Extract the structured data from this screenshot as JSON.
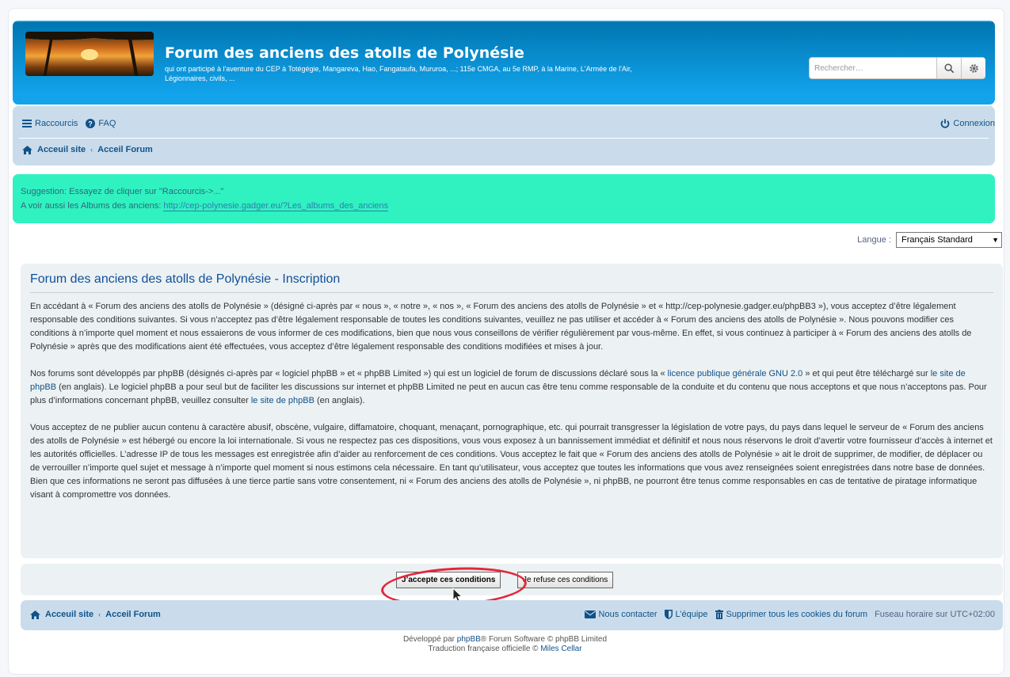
{
  "header": {
    "site_title": "Forum des anciens des atolls de Polynésie",
    "site_description": "qui ont participé à l'aventure du CEP à Totégégie, Mangareva, Hao, Fangataufa, Mururoa, ...; 115e CMGA, au 5e RMP, à la Marine, L'Armée de l'Air, Légionnaires, civils, ...",
    "search_placeholder": "Rechercher…"
  },
  "navbar": {
    "shortcuts_label": "Raccourcis",
    "faq_label": "FAQ",
    "login_label": "Connexion",
    "breadcrumb": [
      "Acceuil site",
      "Acceil Forum"
    ]
  },
  "notice": {
    "line1": "Suggestion: Essayez de cliquer sur \"Raccourcis->...\"",
    "line2_prefix": "A voir aussi les Albums des anciens: ",
    "line2_link": "http://cep-polynesie.gadger.eu/?Les_albums_des_anciens"
  },
  "language": {
    "label": "Langue :",
    "selected": "Français Standard"
  },
  "terms": {
    "title": "Forum des anciens des atolls de Polynésie - Inscription",
    "para1": "En accédant à « Forum des anciens des atolls de Polynésie » (désigné ci-après par « nous », « notre », « nos », « Forum des anciens des atolls de Polynésie » et « http://cep-polynesie.gadger.eu/phpBB3 »), vous acceptez d’être légalement responsable des conditions suivantes. Si vous n’acceptez pas d’être légalement responsable de toutes les conditions suivantes, veuillez ne pas utiliser et accéder à « Forum des anciens des atolls de Polynésie ». Nous pouvons modifier ces conditions à n’importe quel moment et nous essaierons de vous informer de ces modifications, bien que nous vous conseillons de vérifier régulièrement par vous-même. En effet, si vous continuez à participer à « Forum des anciens des atolls de Polynésie » après que des modifications aient été effectuées, vous acceptez d’être légalement responsable des conditions modifiées et mises à jour.",
    "para2_a": "Nos forums sont développés par phpBB (désignés ci-après par « logiciel phpBB » et « phpBB Limited ») qui est un logiciel de forum de discussions déclaré sous la « ",
    "para2_link1": "licence publique générale GNU 2.0",
    "para2_b": " » et qui peut être téléchargé sur ",
    "para2_link2": "le site de phpBB",
    "para2_c": " (en anglais). Le logiciel phpBB a pour seul but de faciliter les discussions sur internet et phpBB Limited ne peut en aucun cas être tenu comme responsable de la conduite et du contenu que nous acceptons et que nous n’acceptons pas. Pour plus d’informations concernant phpBB, veuillez consulter ",
    "para2_link3": "le site de phpBB",
    "para2_d": " (en anglais).",
    "para3": "Vous acceptez de ne publier aucun contenu à caractère abusif, obscène, vulgaire, diffamatoire, choquant, menaçant, pornographique, etc. qui pourrait transgresser la législation de votre pays, du pays dans lequel le serveur de « Forum des anciens des atolls de Polynésie » est hébergé ou encore la loi internationale. Si vous ne respectez pas ces dispositions, vous vous exposez à un bannissement immédiat et définitif et nous nous réservons le droit d’avertir votre fournisseur d’accès à internet et les autorités officielles. L’adresse IP de tous les messages est enregistrée afin d’aider au renforcement de ces conditions. Vous acceptez le fait que « Forum des anciens des atolls de Polynésie » ait le droit de supprimer, de modifier, de déplacer ou de verrouiller n’importe quel sujet et message à n’importe quel moment si nous estimons cela nécessaire. En tant qu’utilisateur, vous acceptez que toutes les informations que vous avez renseignées soient enregistrées dans notre base de données. Bien que ces informations ne seront pas diffusées à une tierce partie sans votre consentement, ni « Forum des anciens des atolls de Polynésie », ni phpBB, ne pourront être tenus comme responsables en cas de tentative de piratage informatique visant à compromettre vos données."
  },
  "buttons": {
    "accept": "J’accepte ces conditions",
    "refuse": "Je refuse ces conditions"
  },
  "footer": {
    "breadcrumb": [
      "Acceuil site",
      "Acceil Forum"
    ],
    "contact": "Nous contacter",
    "team": "L’équipe",
    "delete_cookies": "Supprimer tous les cookies du forum",
    "timezone": "Fuseau horaire sur UTC+02:00",
    "powered_prefix": "Développé par ",
    "powered_link": "phpBB",
    "powered_suffix": "® Forum Software © phpBB Limited",
    "translation_prefix": "Traduction française officielle © ",
    "translation_link": "Miles Cellar"
  },
  "colors": {
    "header_blue": "#12a3eb",
    "navbar": "#cadceb",
    "notice": "#30f2c0",
    "link": "#105289",
    "annotation_ring": "#e3263a"
  }
}
